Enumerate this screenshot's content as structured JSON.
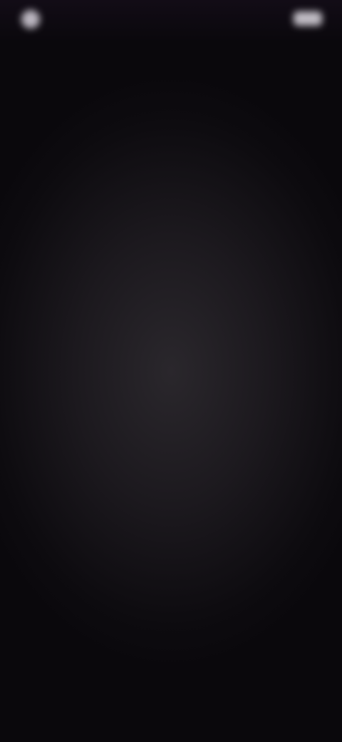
{
  "status_bar": {
    "left_text": "",
    "right_text": ""
  },
  "message": {
    "text": "",
    "link_label": ""
  },
  "colors": {
    "background": "#0a080c",
    "vignette_center": "#2a272c",
    "text": "#d8d5db"
  }
}
